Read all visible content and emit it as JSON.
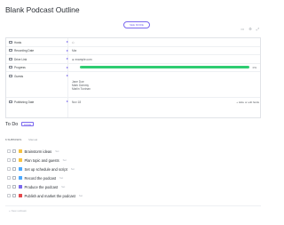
{
  "page": {
    "title": "Blank Podcast Outline",
    "see_more": "SEE MORE",
    "top_icons": [
      "comment-icon",
      "settings-icon",
      "link-icon"
    ]
  },
  "fields": [
    {
      "name": "Hosts",
      "value": "",
      "type": "people"
    },
    {
      "name": "Recording Date",
      "value": "Mar",
      "type": "date"
    },
    {
      "name": "Drive Link",
      "value": "example.com",
      "type": "url"
    },
    {
      "name": "Progress",
      "value": "0%",
      "progress": 1.0,
      "type": "progress"
    },
    {
      "name": "Guests",
      "value": "",
      "guests": [
        "Jane Doe",
        "Mark Dammy",
        "Marlin Tuninan"
      ],
      "type": "text"
    },
    {
      "name": "Publishing Date",
      "value": "Nov 18",
      "type": "date"
    }
  ],
  "hide_empty": "+ Hide or edit fields",
  "todo": {
    "title": "To Do",
    "badge": "DONE",
    "subtasks_label": "6 SUBTASKS",
    "sort_label": "Manual",
    "items": [
      {
        "label": "Brainstorm ideas",
        "meta": "Set",
        "flag": "#f5c242"
      },
      {
        "label": "Plan topic and guests",
        "meta": "Set",
        "flag": "#f5c242"
      },
      {
        "label": "Set up schedule and script",
        "meta": "Set",
        "flag": "#4aa8ff"
      },
      {
        "label": "Record the podcast",
        "meta": "Set",
        "flag": "#4aa8ff"
      },
      {
        "label": "Produce the podcast",
        "meta": "Set",
        "flag": "#7b68ee"
      },
      {
        "label": "Publish and market the podcast",
        "meta": "Set",
        "flag": "#e5484d"
      }
    ],
    "new_subtask": "+ New subtask"
  }
}
